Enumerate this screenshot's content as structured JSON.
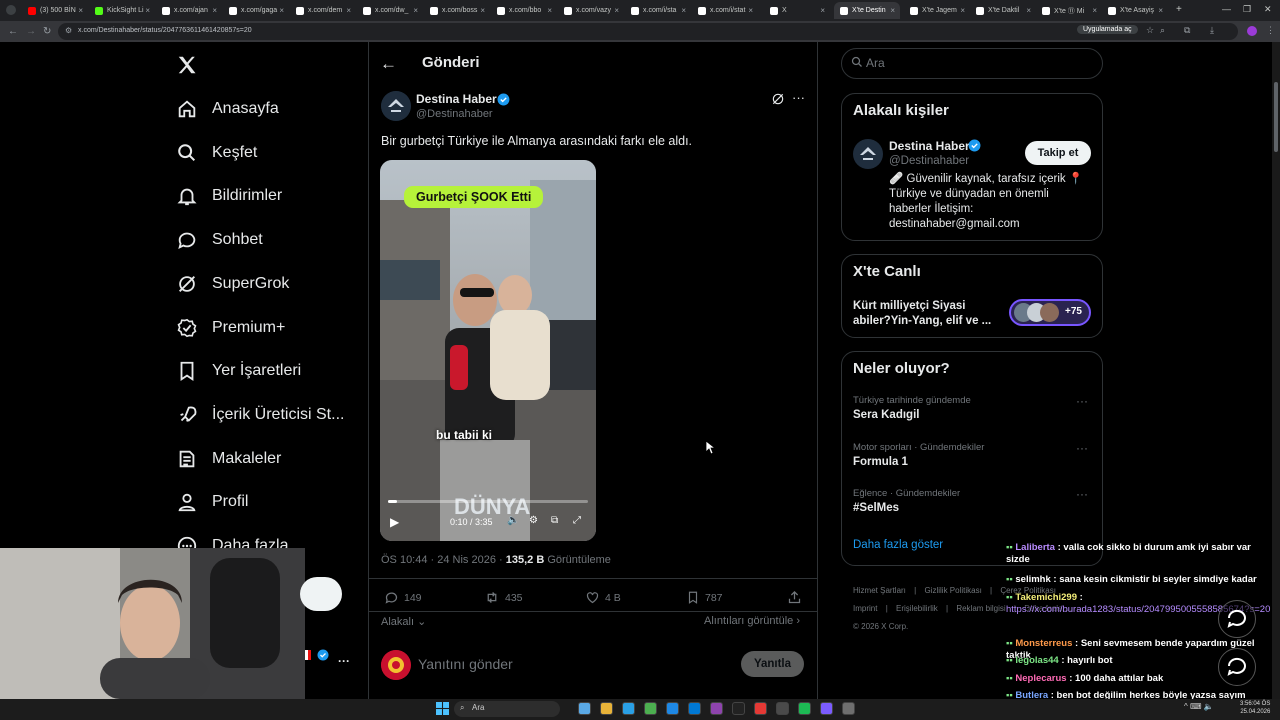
{
  "browser": {
    "tabs": [
      {
        "label": "(3) 500 BİN",
        "color": "#ff0000"
      },
      {
        "label": "KickSight Li",
        "color": "#53fc18"
      },
      {
        "label": "x.com/ajan",
        "color": "#fff"
      },
      {
        "label": "x.com/gaga",
        "color": "#fff"
      },
      {
        "label": "x.com/dem",
        "color": "#fff"
      },
      {
        "label": "x.com/dw_",
        "color": "#fff"
      },
      {
        "label": "x.com/boss",
        "color": "#fff"
      },
      {
        "label": "x.com/bbo",
        "color": "#fff"
      },
      {
        "label": "x.com/vazy",
        "color": "#fff"
      },
      {
        "label": "x.com/i/sta",
        "color": "#fff"
      },
      {
        "label": "x.com/i/stat",
        "color": "#fff"
      },
      {
        "label": "X",
        "color": "#fff"
      },
      {
        "label": "X'te Destin",
        "color": "#fff"
      },
      {
        "label": "X'te Jagem",
        "color": "#fff"
      },
      {
        "label": "X'te Daktil",
        "color": "#fff"
      },
      {
        "label": "X'te ⑪ Mi",
        "color": "#fff"
      },
      {
        "label": "X'te Asayiş",
        "color": "#fff"
      }
    ],
    "url": "x.com/Destinahaber/status/2047763611461420857s=20",
    "app_pill": "Uygulamada aç"
  },
  "nav": {
    "items": [
      {
        "label": "Anasayfa",
        "icon": "home-icon"
      },
      {
        "label": "Keşfet",
        "icon": "search-icon"
      },
      {
        "label": "Bildirimler",
        "icon": "bell-icon"
      },
      {
        "label": "Sohbet",
        "icon": "chat-icon"
      },
      {
        "label": "SuperGrok",
        "icon": "grok-icon"
      },
      {
        "label": "Premium+",
        "icon": "premium-icon"
      },
      {
        "label": "Yer İşaretleri",
        "icon": "bookmark-icon"
      },
      {
        "label": "İçerik Üreticisi St...",
        "icon": "rocket-icon"
      },
      {
        "label": "Makaleler",
        "icon": "article-icon"
      },
      {
        "label": "Profil",
        "icon": "person-icon"
      },
      {
        "label": "Daha fazla",
        "icon": "more-icon"
      }
    ]
  },
  "post": {
    "header_title": "Gönderi",
    "author_name": "Destina Haber",
    "author_handle": "@Destinahaber",
    "text": "Bir gurbetçi Türkiye ile Almanya arasındaki farkı ele aldı.",
    "video": {
      "top_caption": "Gurbetçi ŞOOK  Etti",
      "subtitle": "bu tabii ki",
      "watermark": "DÜNYA",
      "time": "0:10 / 3:35",
      "progress": 0.047
    },
    "timestamp": "ÖS 10:44 · 24 Nis 2026 · ",
    "views_count": "135,2 B",
    "views_label": "Görüntüleme",
    "replies": "149",
    "reposts": "435",
    "likes": "4 B",
    "bookmarks": "787",
    "sort_label": "Alakalı",
    "quotes_link": "Alıntıları görüntüle",
    "reply_placeholder": "Yanıtını gönder",
    "reply_button": "Yanıtla"
  },
  "right": {
    "search_placeholder": "Ara",
    "related_title": "Alakalı kişiler",
    "related_name": "Destina Haber",
    "related_handle": "@Destinahaber",
    "follow_label": "Takip et",
    "related_bio": "🩹 Güvenilir kaynak, tarafsız içerik 📍 Türkiye ve dünyadan en önemli haberler İletişim: destinahaber@gmail.com",
    "live_title": "X'te Canlı",
    "live_text": "Kürt milliyetçi Siyasi abiler?Yin-Yang, elif ve ...",
    "live_count": "+75",
    "trends_title": "Neler oluyor?",
    "trends": [
      {
        "context": "Türkiye tarihinde gündemde",
        "name": "Sera Kadıgil"
      },
      {
        "context": "Motor sporları · Gündemdekiler",
        "name": "Formula 1"
      },
      {
        "context": "Eğlence · Gündemdekiler",
        "name": "#SelMes"
      }
    ],
    "show_more": "Daha fazla göster",
    "footer": [
      "Hizmet Şartları",
      "Gizlilik Politikası",
      "Çerez Politikası",
      "Imprint",
      "Erişilebilirlik",
      "Reklam bilgisi",
      "Daha fazla ...",
      "© 2026 X Corp."
    ]
  },
  "chat": [
    {
      "user": "Laliberta",
      "color": "#b98cff",
      "text": " : valla cok sikko bi durum amk iyi sabır var sizde"
    },
    {
      "user": "selimhk",
      "color": "#ffffff",
      "text": " : sana kesin cikmistir bi seyler simdiye kadar"
    },
    {
      "user": "Takemichi299",
      "color": "#f5f07a",
      "text": " :"
    },
    {
      "user": "",
      "color": "#ffffff",
      "text": "https://x.com/burada1283/status/2047995005558585674?s=20",
      "link": true
    },
    {
      "user": "Monsterreus",
      "color": "#ff9a4a",
      "text": " : Seni sevmesem bende yapardım güzel taktik"
    },
    {
      "user": "legolas44",
      "color": "#7ee787",
      "text": " : hayırlı bot"
    },
    {
      "user": "Neplecarus",
      "color": "#ff6bb5",
      "text": " : 100 daha attılar bak"
    },
    {
      "user": "Butlera",
      "color": "#7aa7ff",
      "text": " : ben bot değilim herkes böyle yazsa sayım yaparız bence"
    }
  ],
  "taskbar": {
    "search_placeholder": "Ara",
    "time": "3:56:04 ÖS",
    "date": "25.04.2026"
  },
  "colors": {
    "accent": "#1d9bf0",
    "verified": "#1d9bf0",
    "caption_bg": "#b6f23a"
  }
}
